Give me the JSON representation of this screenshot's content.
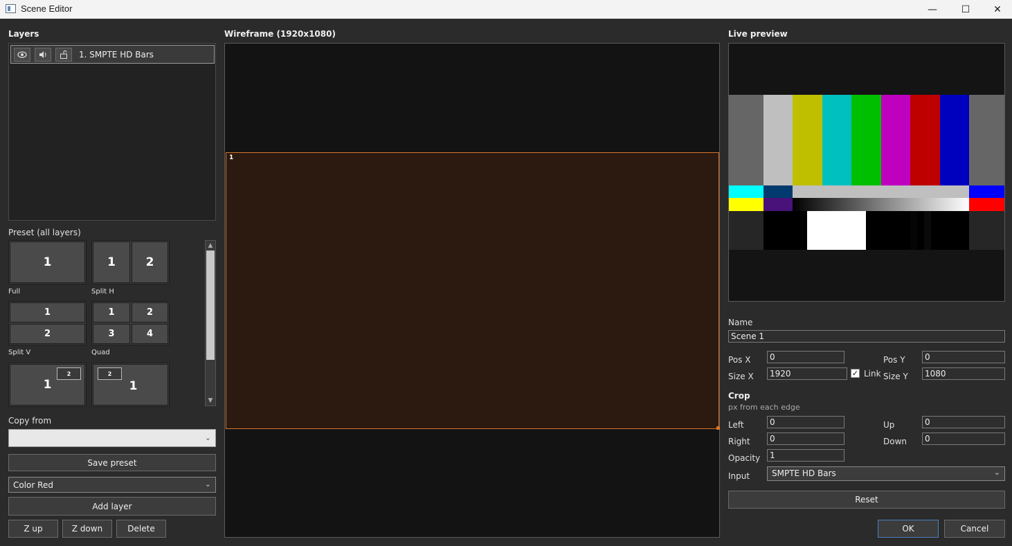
{
  "window": {
    "title": "Scene Editor",
    "minimize": "—",
    "maximize": "☐",
    "close": "✕"
  },
  "layers": {
    "heading": "Layers",
    "items": [
      {
        "name": "1. SMPTE HD Bars",
        "icons": [
          "eye-icon",
          "speaker-icon",
          "lock-icon"
        ]
      }
    ]
  },
  "preset": {
    "heading": "Preset (all layers)",
    "tiles": [
      {
        "label": "Full",
        "cells": [
          "1"
        ]
      },
      {
        "label": "Split H",
        "cells": [
          "1",
          "2"
        ]
      },
      {
        "label": "Split V",
        "cells": [
          "1",
          "2"
        ]
      },
      {
        "label": "Quad",
        "cells": [
          "1",
          "2",
          "3",
          "4"
        ]
      },
      {
        "label": "",
        "cells": [
          "1",
          "2"
        ]
      },
      {
        "label": "",
        "cells": [
          "2",
          "1"
        ]
      }
    ]
  },
  "copy_from": {
    "label": "Copy from",
    "value": ""
  },
  "save_preset": "Save preset",
  "source_select": {
    "value": "Color Red"
  },
  "add_layer": "Add layer",
  "z_up": "Z up",
  "z_down": "Z down",
  "delete": "Delete",
  "wireframe": {
    "heading": "Wireframe (1920x1080)",
    "layer_number": "1"
  },
  "live_preview": {
    "heading": "Live preview"
  },
  "props": {
    "name_label": "Name",
    "name_value": "Scene 1",
    "pos_x_label": "Pos X",
    "pos_x": "0",
    "pos_y_label": "Pos Y",
    "pos_y": "0",
    "size_x_label": "Size X",
    "size_x": "1920",
    "link_label": "Link",
    "link_checked": true,
    "size_y_label": "Size Y",
    "size_y": "1080",
    "crop_heading": "Crop",
    "crop_hint": "px from each edge",
    "left_label": "Left",
    "left": "0",
    "up_label": "Up",
    "up": "0",
    "right_label": "Right",
    "right": "0",
    "down_label": "Down",
    "down": "0",
    "opacity_label": "Opacity",
    "opacity": "1",
    "input_label": "Input",
    "input": "SMPTE HD Bars"
  },
  "reset": "Reset",
  "ok": "OK",
  "cancel": "Cancel",
  "colors": {
    "accent": "#d8772e",
    "ok_border": "#4a7fc1"
  }
}
